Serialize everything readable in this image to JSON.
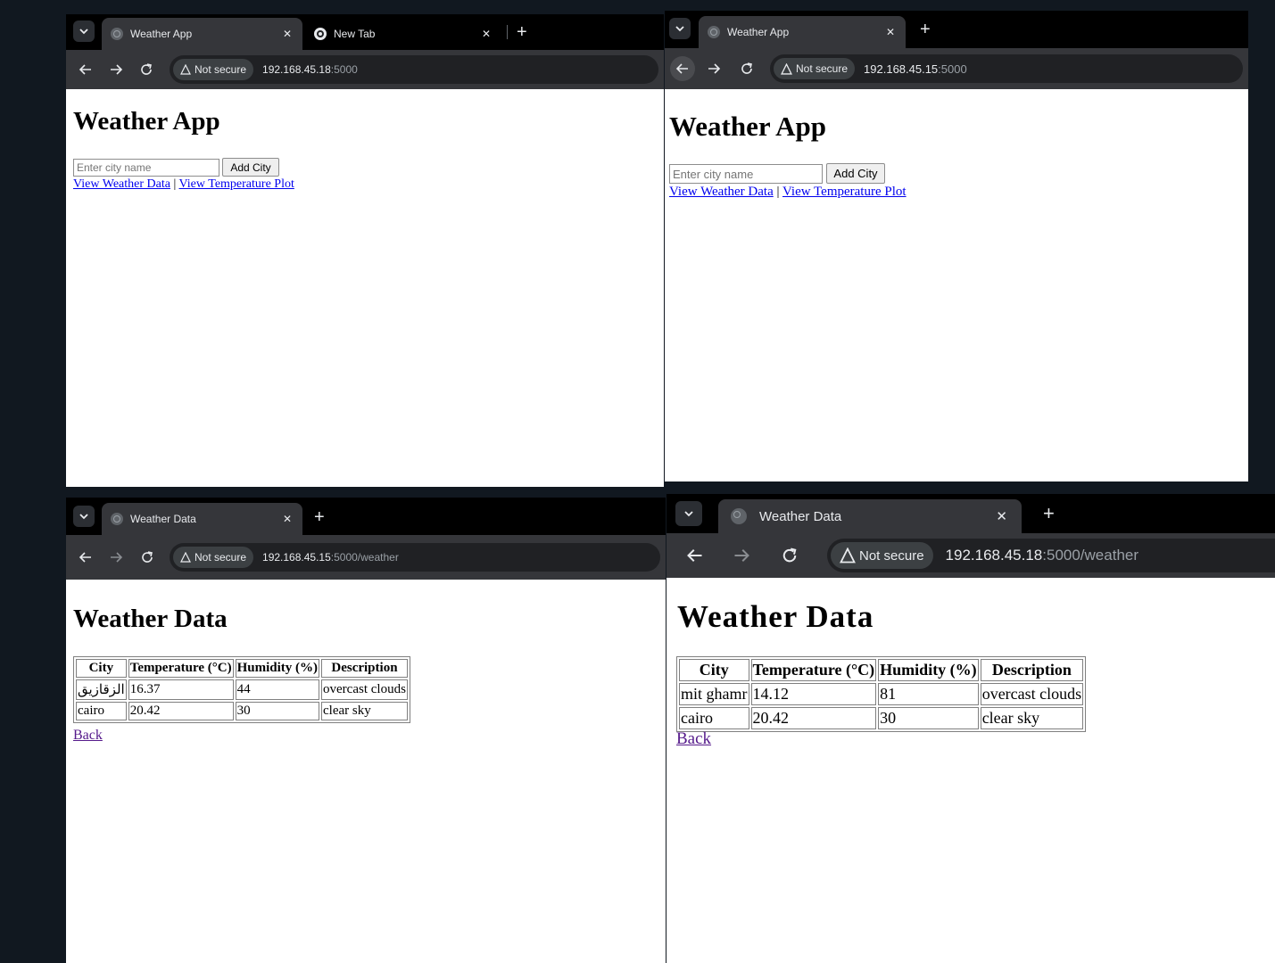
{
  "windows": {
    "tl": {
      "tabs": [
        {
          "title": "Weather App",
          "favicon": "globe-icon",
          "active": true
        },
        {
          "title": "New Tab",
          "favicon": "chrome-icon",
          "active": false
        }
      ],
      "security": "Not secure",
      "url_host": "192.168.45.18",
      "url_path": ":5000",
      "heading": "Weather App",
      "input_placeholder": "Enter city name",
      "button_label": "Add City",
      "link1": "View Weather Data",
      "separator": "|",
      "link2": "View Temperature Plot"
    },
    "tr": {
      "tabs": [
        {
          "title": "Weather App",
          "favicon": "globe-icon",
          "active": true
        }
      ],
      "security": "Not secure",
      "url_host": "192.168.45.15",
      "url_path": ":5000",
      "heading": "Weather App",
      "input_placeholder": "Enter city name",
      "button_label": "Add City",
      "link1": "View Weather Data",
      "separator": "|",
      "link2": "View Temperature Plot"
    },
    "bl": {
      "tabs": [
        {
          "title": "Weather Data",
          "favicon": "globe-icon",
          "active": true
        }
      ],
      "security": "Not secure",
      "url_host": "192.168.45.15",
      "url_path": ":5000/weather",
      "heading": "Weather Data",
      "table": {
        "headers": [
          "City",
          "Temperature (°C)",
          "Humidity (%)",
          "Description"
        ],
        "rows": [
          [
            "الزقازيق",
            "16.37",
            "44",
            "overcast clouds"
          ],
          [
            "cairo",
            "20.42",
            "30",
            "clear sky"
          ]
        ]
      },
      "back": "Back"
    },
    "br": {
      "tabs": [
        {
          "title": "Weather Data",
          "favicon": "globe-icon",
          "active": true
        }
      ],
      "security": "Not secure",
      "url_host": "192.168.45.18",
      "url_path": ":5000/weather",
      "heading": "Weather Data",
      "table": {
        "headers": [
          "City",
          "Temperature (°C)",
          "Humidity (%)",
          "Description"
        ],
        "rows": [
          [
            "mit ghamr",
            "14.12",
            "81",
            "overcast clouds"
          ],
          [
            "cairo",
            "20.42",
            "30",
            "clear sky"
          ]
        ]
      },
      "back": "Back"
    }
  },
  "colors": {
    "background": "#111820",
    "tab_strip": "#000000",
    "toolbar": "#35363a",
    "omnibox": "#202124",
    "link": "#0000ee",
    "visited_link": "#551a8b"
  }
}
